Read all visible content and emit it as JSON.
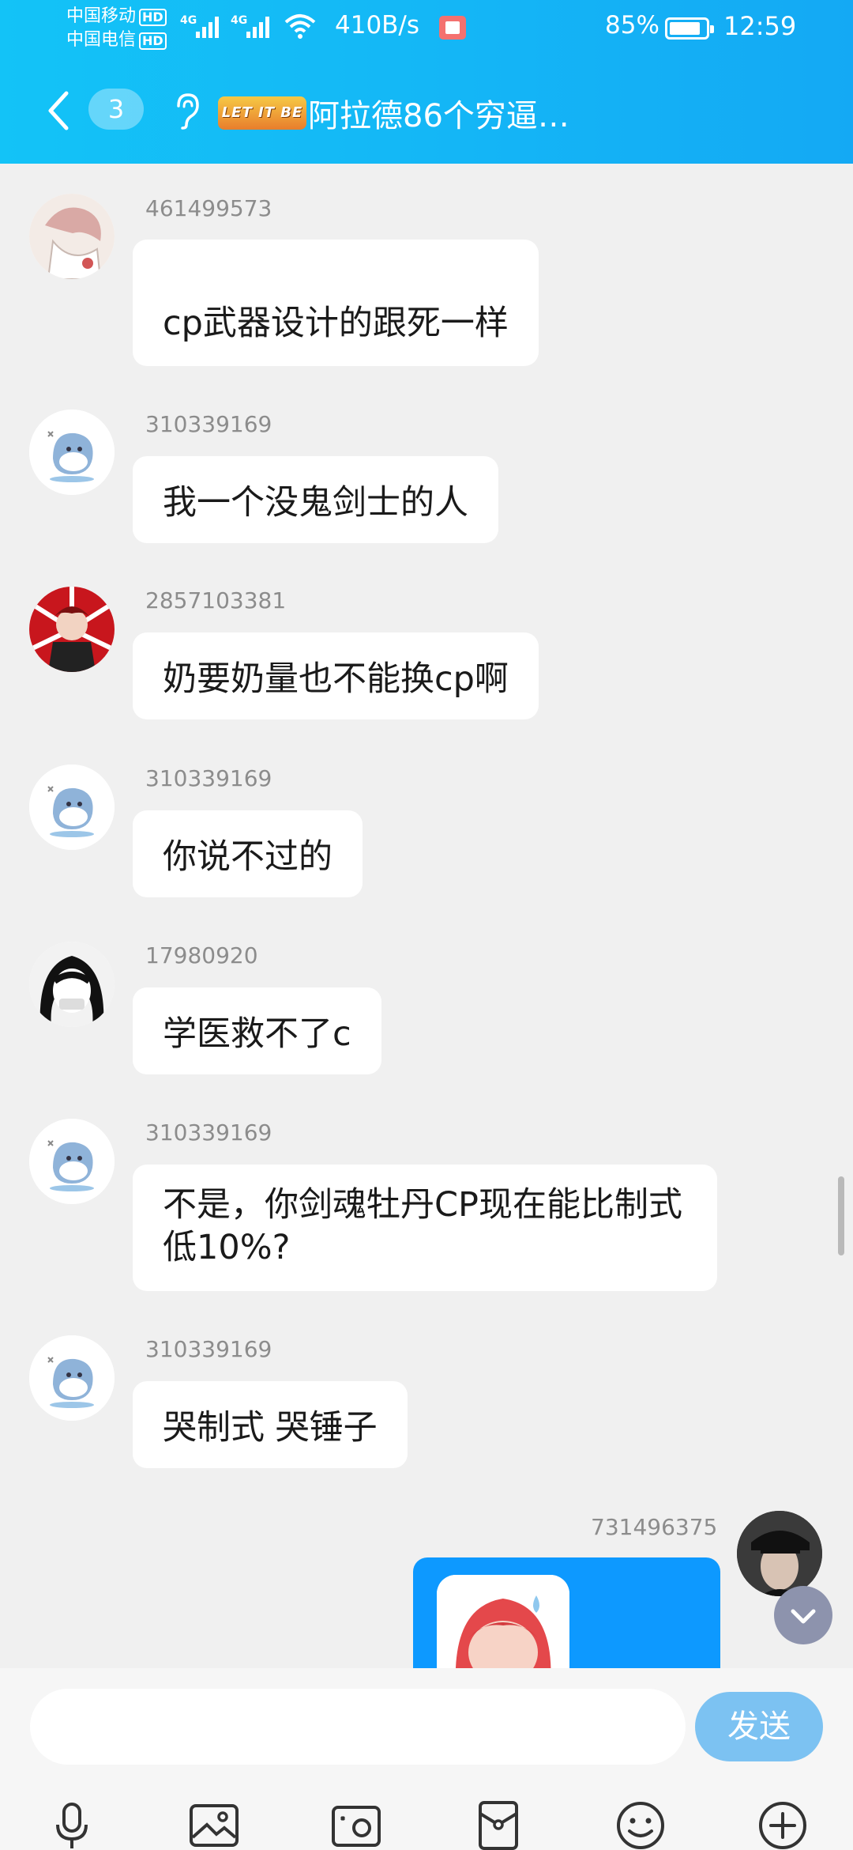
{
  "status_bar": {
    "carrier1": "中国移动",
    "carrier2": "中国电信",
    "hd": "HD",
    "net": "4G",
    "speed": "410B/s",
    "battery": "85%",
    "time": "12:59"
  },
  "header": {
    "unread_count": "3",
    "logo_text": "LET IT BE",
    "title": "阿拉德86个穷逼…"
  },
  "messages": [
    {
      "sender": "461499573",
      "text": "cp武器设计的跟死一样"
    },
    {
      "sender": "310339169",
      "text": "我一个没鬼剑士的人"
    },
    {
      "sender": "2857103381",
      "text": "奶要奶量也不能换cp啊"
    },
    {
      "sender": "310339169",
      "text": "你说不过的"
    },
    {
      "sender": "17980920",
      "text": "学医救不了c"
    },
    {
      "sender": "310339169",
      "text": "不是，你剑魂牡丹CP现在能比制式低10%?"
    },
    {
      "sender": "310339169",
      "text": "哭制式  哭锤子"
    }
  ],
  "my_message": {
    "sender": "731496375"
  },
  "input": {
    "placeholder": "",
    "send_label": "发送"
  },
  "toolbar": [
    "mic-icon",
    "image-icon",
    "camera-icon",
    "red-packet-icon",
    "emoji-icon",
    "plus-icon"
  ],
  "colors": {
    "header": "#14b7f6",
    "send": "#7cc2f2",
    "my_bubble": "#0d99ff",
    "background": "#f0f0f0"
  }
}
